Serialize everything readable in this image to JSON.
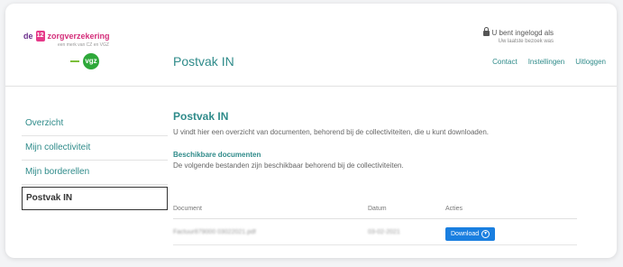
{
  "brand": {
    "prefix": "de",
    "badge": "12",
    "name": "zorgverzekering",
    "tagline": "een merk van CZ en VGZ",
    "partner": "vgz"
  },
  "header": {
    "title": "Postvak IN",
    "user_status": "U bent ingelogd als",
    "last_visit": "Uw laatste bezoek was",
    "links": [
      "Contact",
      "Instellingen",
      "Uitloggen"
    ]
  },
  "sidebar": {
    "items": [
      {
        "label": "Overzicht",
        "active": false
      },
      {
        "label": "Mijn collectiviteit",
        "active": false
      },
      {
        "label": "Mijn borderellen",
        "active": false
      },
      {
        "label": "Postvak IN",
        "active": true
      }
    ]
  },
  "main": {
    "title": "Postvak IN",
    "description": "U vindt hier een overzicht van documenten, behorend bij de collectiviteiten, die u kunt downloaden.",
    "section_title": "Beschikbare documenten",
    "section_description": "De volgende bestanden zijn beschikbaar behorend bij de collectiviteiten."
  },
  "table": {
    "headers": [
      "Document",
      "Datum",
      "Acties"
    ],
    "rows": [
      {
        "document": "Factuur879000 03022021.pdf",
        "date": "03-02-2021",
        "action": "Download"
      }
    ]
  },
  "colors": {
    "accent": "#2f8b8a",
    "button": "#1a7fe0",
    "brand_pink": "#d42e7a",
    "brand_purple": "#6b2f8c",
    "vgz_green": "#2ea83a"
  }
}
